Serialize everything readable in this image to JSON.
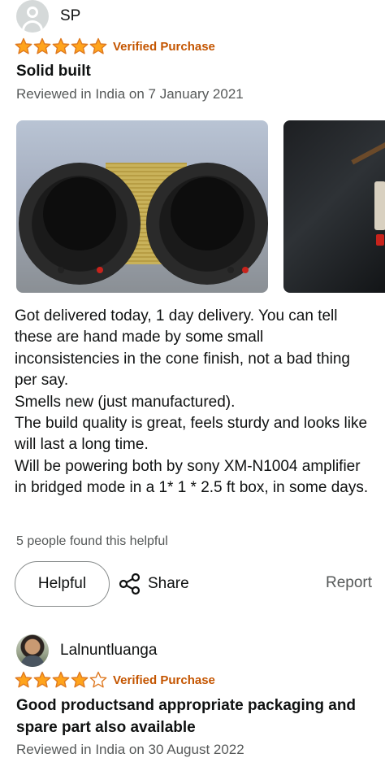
{
  "reviews": [
    {
      "reviewer": "SP",
      "rating": 5,
      "max_rating": 5,
      "verified": "Verified Purchase",
      "title": "Solid built",
      "date": "Reviewed in India on 7 January 2021",
      "body": [
        "Got delivered today, 1 day delivery. You can tell these are hand made by some small inconsistencies in the cone finish, not a bad thing per say.",
        "Smells new (just manufactured).",
        "The build quality is great, feels sturdy and looks like will last a long time.",
        "Will be powering both by sony XM-N1004 amplifier in bridged mode in a 1* 1 * 2.5 ft box, in some days."
      ],
      "helpful_count": "5 people found this helpful",
      "actions": {
        "helpful": "Helpful",
        "share": "Share",
        "report": "Report"
      }
    },
    {
      "reviewer": "Lalnuntluanga",
      "rating": 4,
      "max_rating": 5,
      "verified": "Verified Purchase",
      "title": "Good productsand appropriate packaging and spare part also available",
      "date": "Reviewed in India on 30 August 2022"
    }
  ],
  "colors": {
    "star": "#ffa41c",
    "star_outline": "#de7921",
    "verified": "#c45500",
    "secondary_text": "#565959",
    "primary_text": "#0f1111"
  },
  "icons": {
    "avatar_default": "person-silhouette-icon",
    "share": "share-icon",
    "star_filled": "star-filled-icon",
    "star_empty": "star-empty-icon"
  }
}
